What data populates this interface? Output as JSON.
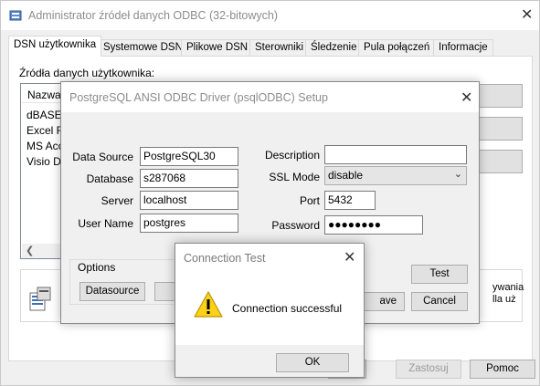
{
  "main_window": {
    "title": "Administrator źródeł danych ODBC (32-bitowych)",
    "tabs": [
      {
        "label": "DSN użytkownika",
        "active": true
      },
      {
        "label": "Systemowe DSN"
      },
      {
        "label": "Plikowe DSN"
      },
      {
        "label": "Sterowniki"
      },
      {
        "label": "Śledzenie"
      },
      {
        "label": "Pula połączeń"
      },
      {
        "label": "Informacje"
      }
    ],
    "sources_label": "Źródła danych użytkownika:",
    "list_header": "Nazwa",
    "list_items": [
      "dBASE",
      "Excel Fi",
      "MS Acc",
      "Visio Da"
    ],
    "info_text": [
      "ywania",
      "lla uż"
    ],
    "buttons": {
      "ok_partial": "",
      "cancel_partial": "ave",
      "apply": "Zastosuj",
      "help": "Pomoc"
    }
  },
  "setup_dialog": {
    "title": "PostgreSQL ANSI ODBC Driver (psqlODBC) Setup",
    "data_source_label": "Data Source",
    "data_source_value": "PostgreSQL30",
    "database_label": "Database",
    "database_value": "s287068",
    "server_label": "Server",
    "server_value": "localhost",
    "user_name_label": "User Name",
    "user_name_value": "postgres",
    "description_label": "Description",
    "description_value": "",
    "ssl_mode_label": "SSL Mode",
    "ssl_mode_value": "disable",
    "port_label": "Port",
    "port_value": "5432",
    "password_label": "Password",
    "password_value": "●●●●●●●●",
    "options_label": "Options",
    "datasource_button": "Datasource",
    "test_button": "Test",
    "save_button_partial": "ave",
    "cancel_button": "Cancel"
  },
  "conn_dialog": {
    "title": "Connection Test",
    "message": "Connection successful",
    "ok_button": "OK",
    "icon": "warning-icon"
  }
}
